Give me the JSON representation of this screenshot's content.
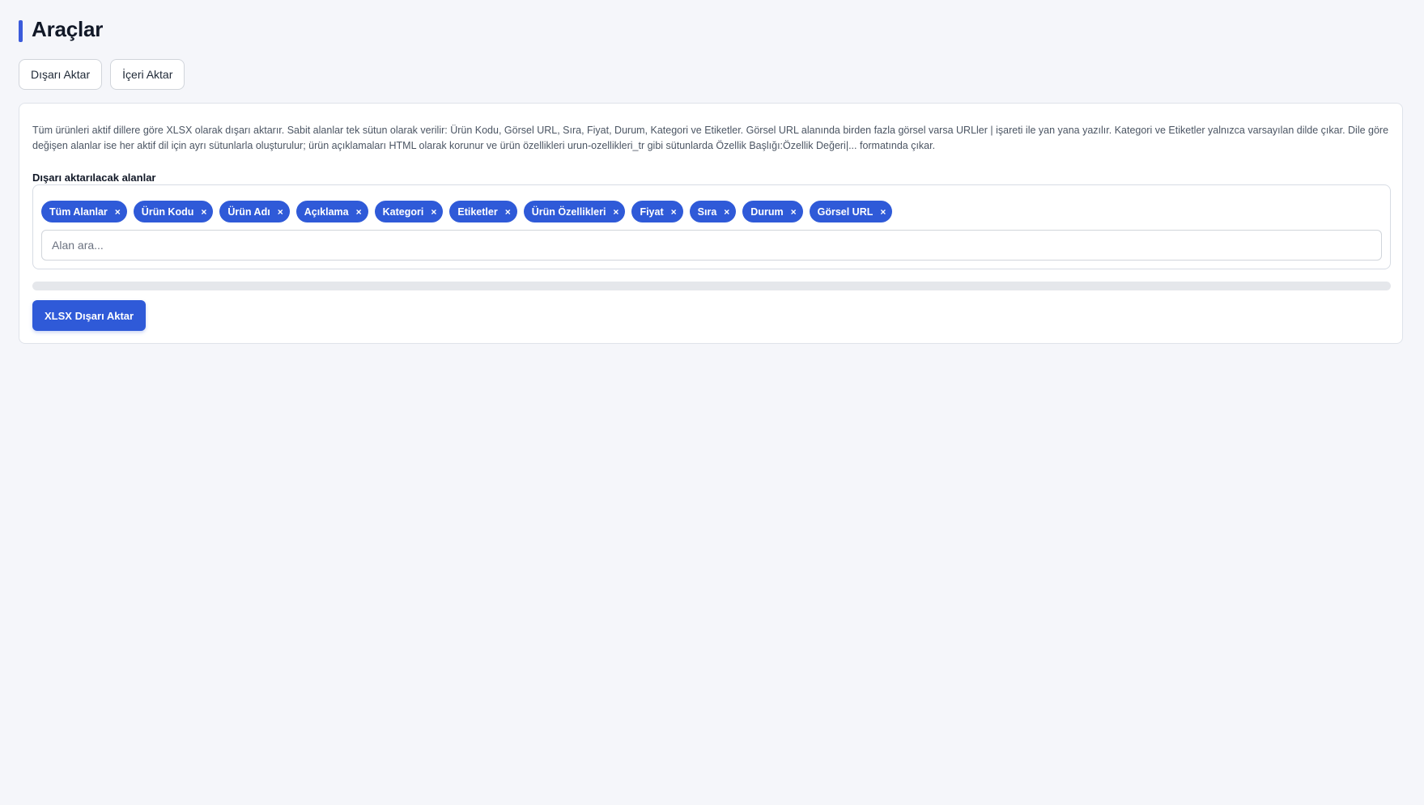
{
  "page": {
    "title": "Araçlar"
  },
  "tabs": [
    {
      "label": "Dışarı Aktar"
    },
    {
      "label": "İçeri Aktar"
    }
  ],
  "export": {
    "description": "Tüm ürünleri aktif dillere göre XLSX olarak dışarı aktarır. Sabit alanlar tek sütun olarak verilir: Ürün Kodu, Görsel URL, Sıra, Fiyat, Durum, Kategori ve Etiketler. Görsel URL alanında birden fazla görsel varsa URLler | işareti ile yan yana yazılır. Kategori ve Etiketler yalnızca varsayılan dilde çıkar. Dile göre değişen alanlar ise her aktif dil için ayrı sütunlarla oluşturulur; ürün açıklamaları HTML olarak korunur ve ürün özellikleri urun-ozellikleri_tr gibi sütunlarda Özellik Başlığı:Özellik Değeri|... formatında çıkar.",
    "fields_label": "Dışarı aktarılacak alanlar",
    "selected_fields": [
      {
        "label": "Tüm Alanlar",
        "remove": "×"
      },
      {
        "label": "Ürün Kodu",
        "remove": "×"
      },
      {
        "label": "Ürün Adı",
        "remove": "×"
      },
      {
        "label": "Açıklama",
        "remove": "×"
      },
      {
        "label": "Kategori",
        "remove": "×"
      },
      {
        "label": "Etiketler",
        "remove": "×"
      },
      {
        "label": "Ürün Özellikleri",
        "remove": "×"
      },
      {
        "label": "Fiyat",
        "remove": "×"
      },
      {
        "label": "Sıra",
        "remove": "×"
      },
      {
        "label": "Durum",
        "remove": "×"
      },
      {
        "label": "Görsel URL",
        "remove": "×"
      }
    ],
    "search": {
      "placeholder": "Alan ara...",
      "value": ""
    },
    "progress": 0,
    "button_label": "XLSX Dışarı Aktar"
  },
  "colors": {
    "accent": "#2f5ad8",
    "title_bar": "#3b5bdb",
    "background": "#f5f6fa"
  },
  "icons": {
    "chip_remove": "close-icon"
  }
}
